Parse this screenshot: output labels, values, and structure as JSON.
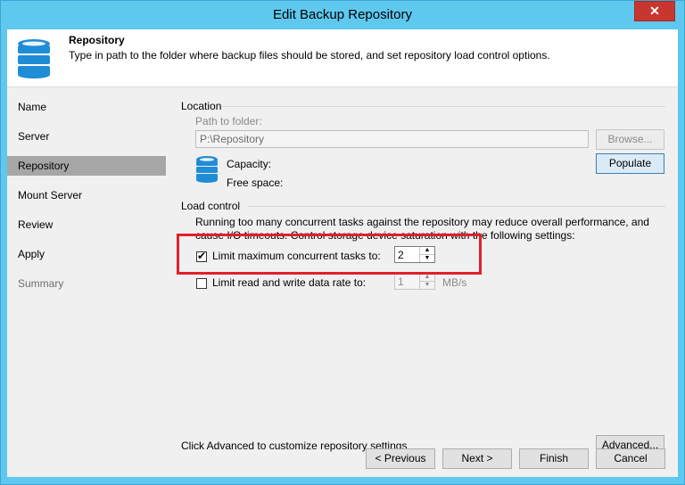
{
  "window": {
    "title": "Edit Backup Repository",
    "close_label": "✕"
  },
  "header": {
    "title": "Repository",
    "description": "Type in path to the folder where backup files should be stored, and set repository load control options."
  },
  "sidebar": {
    "items": [
      {
        "label": "Name"
      },
      {
        "label": "Server"
      },
      {
        "label": "Repository"
      },
      {
        "label": "Mount Server"
      },
      {
        "label": "Review"
      },
      {
        "label": "Apply"
      },
      {
        "label": "Summary"
      }
    ],
    "active_index": 2
  },
  "location": {
    "section_label": "Location",
    "path_label": "Path to folder:",
    "path_value": "P:\\Repository",
    "browse_label": "Browse...",
    "capacity_label": "Capacity:",
    "free_space_label": "Free space:",
    "populate_label": "Populate"
  },
  "load_control": {
    "section_label": "Load control",
    "description_line1": "Running too many concurrent tasks against the repository may reduce overall performance, and",
    "description_line2": "cause I/O timeouts. Control storage device saturation with the following settings:",
    "limit_tasks_label": "Limit maximum concurrent tasks to:",
    "limit_tasks_checked": true,
    "limit_tasks_value": "2",
    "limit_rate_label": "Limit read and write data rate to:",
    "limit_rate_checked": false,
    "limit_rate_value": "1",
    "limit_rate_unit": "MB/s"
  },
  "advanced": {
    "hint": "Click Advanced to customize repository settings",
    "button_label": "Advanced..."
  },
  "footer": {
    "previous_label": "< Previous",
    "next_label": "Next >",
    "finish_label": "Finish",
    "cancel_label": "Cancel"
  },
  "colors": {
    "highlight": "#e0202c",
    "titlebar": "#5ec8ee",
    "close": "#c7372f"
  },
  "icons": {
    "header": "database-icon",
    "capacity": "database-icon"
  }
}
